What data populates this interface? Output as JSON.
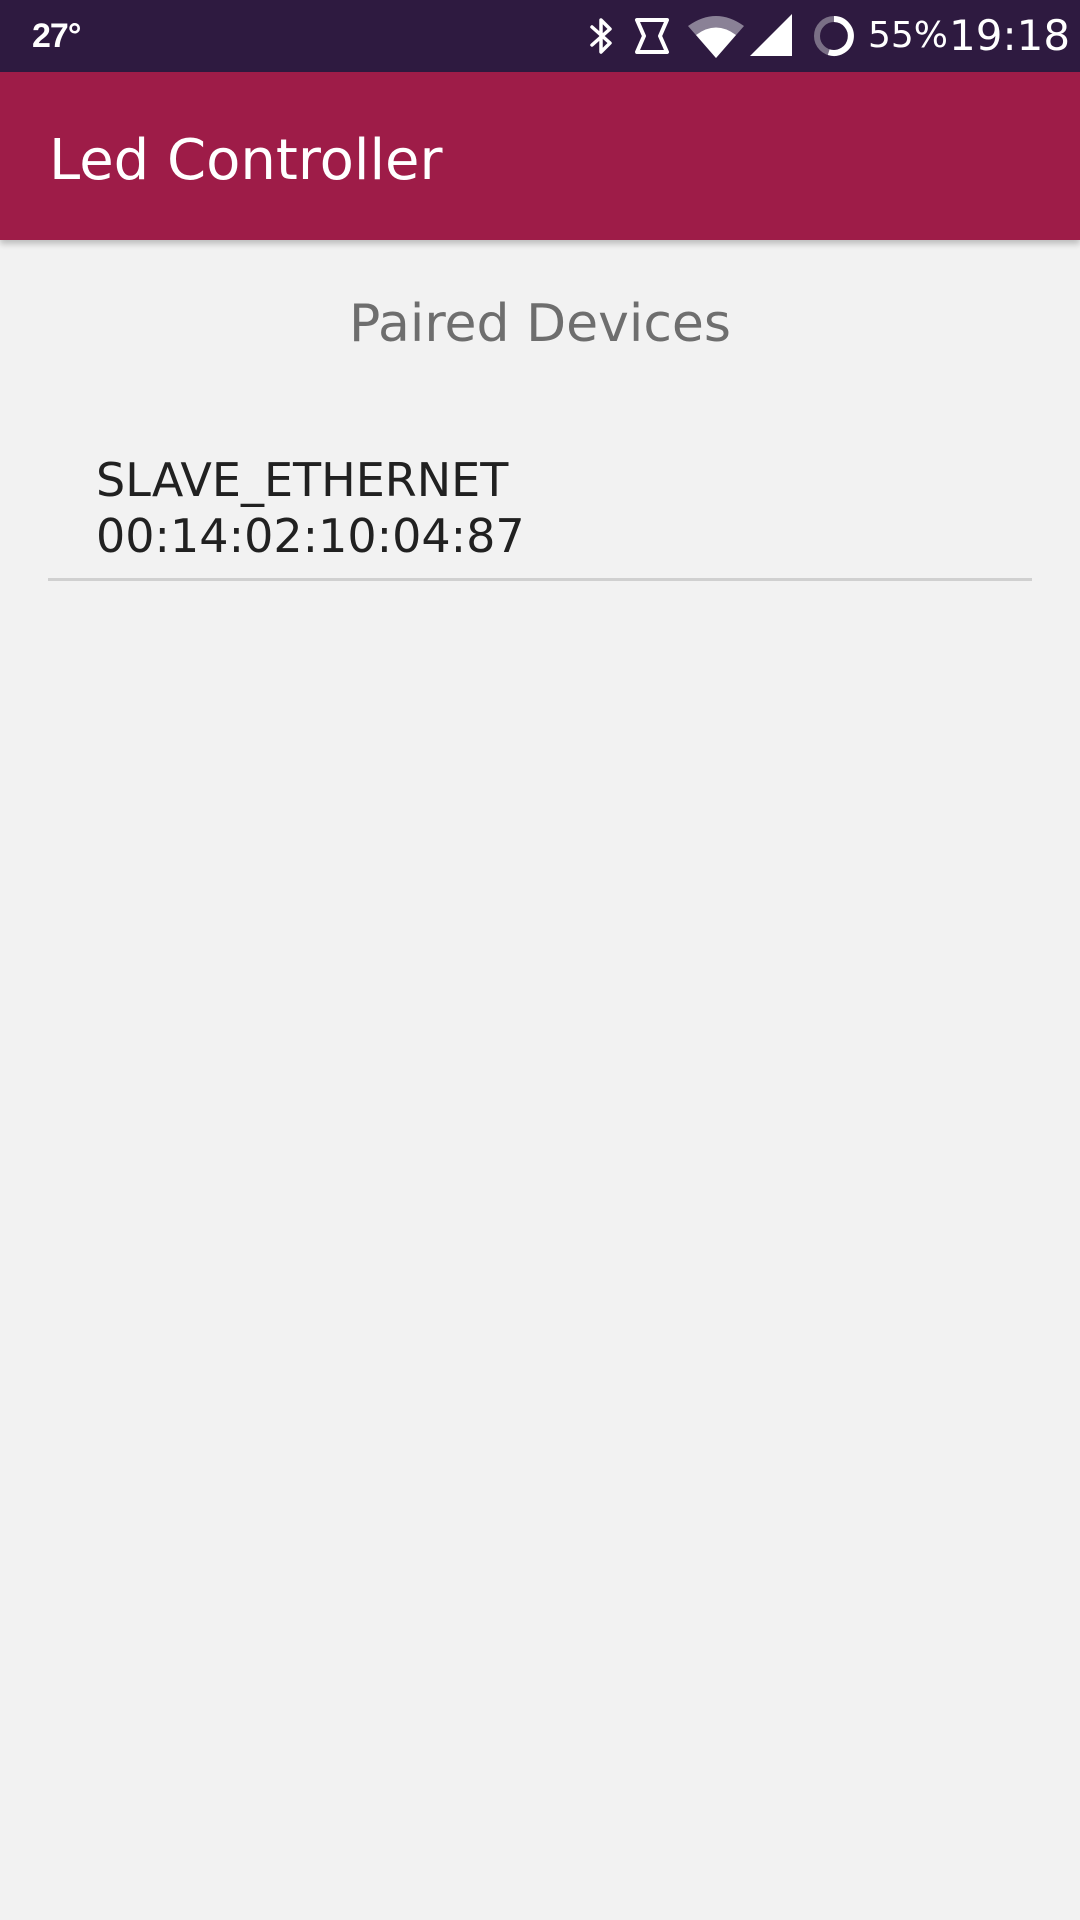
{
  "status_bar": {
    "temperature": "27°",
    "icons": [
      "bluetooth-icon",
      "nfc-icon",
      "wifi-icon",
      "cell-signal-icon",
      "battery-ring-icon"
    ],
    "battery_percent": "55%",
    "time": "19:18"
  },
  "app_bar": {
    "title": "Led Controller"
  },
  "main": {
    "section_title": "Paired Devices",
    "devices": [
      {
        "name": "SLAVE_ETHERNET",
        "address": "00:14:02:10:04:87"
      }
    ]
  },
  "colors": {
    "status_bar": "#2e1a40",
    "app_bar": "#9e1c48",
    "background": "#f2f2f2",
    "section_title": "#6e6e6e",
    "item_text": "#212121",
    "divider": "#d0d0d0"
  }
}
